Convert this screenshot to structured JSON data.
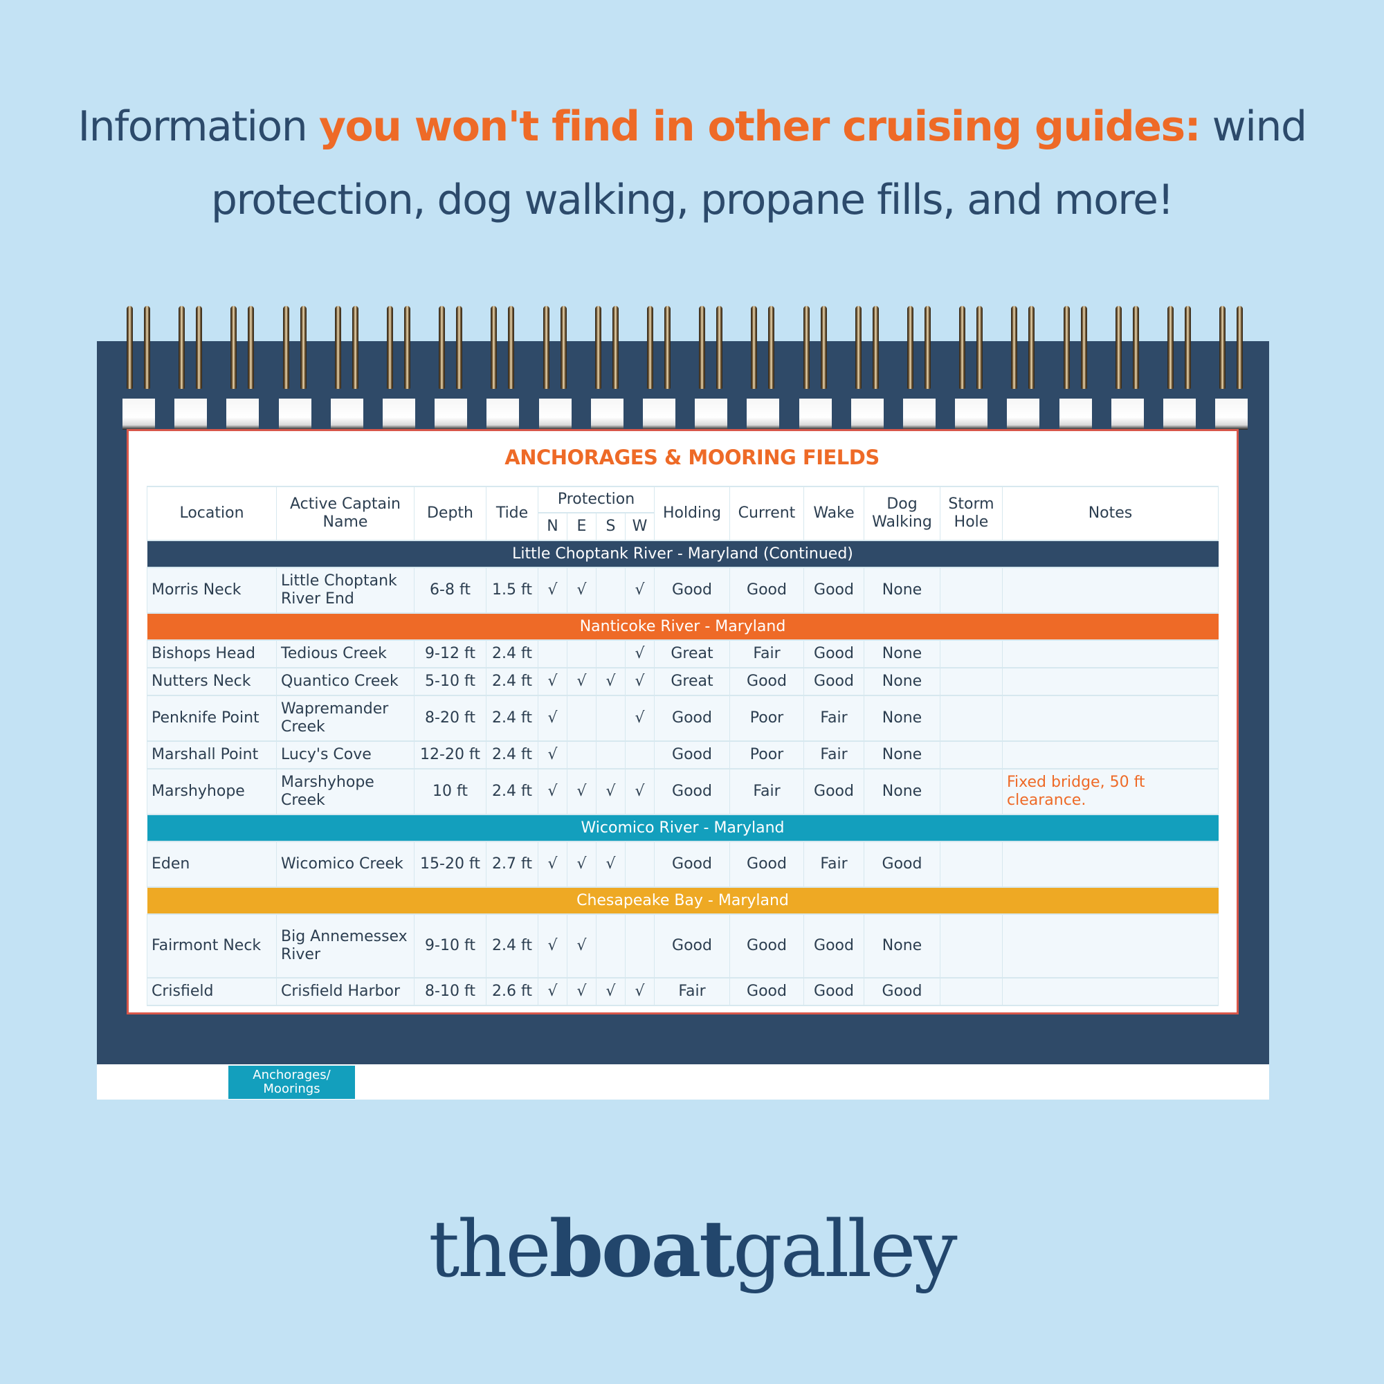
{
  "headline": {
    "part1": "Information ",
    "highlight": "you won't find in other cruising guides:",
    "part2": " wind protection, dog walking, propane fills, and more!"
  },
  "colors": {
    "background": "#c3e2f4",
    "navy": "#2f4a68",
    "orange": "#ee6a27",
    "teal": "#139fbd",
    "gold": "#eea924"
  },
  "page": {
    "title": "ANCHORAGES & MOORING FIELDS"
  },
  "table": {
    "headers": {
      "location": "Location",
      "active_captain": "Active Captain Name",
      "depth": "Depth",
      "tide": "Tide",
      "protection": "Protection",
      "directions": [
        "N",
        "E",
        "S",
        "W"
      ],
      "holding": "Holding",
      "current": "Current",
      "wake": "Wake",
      "dog_walking": "Dog Walking",
      "storm_hole": "Storm Hole",
      "notes": "Notes"
    },
    "check_glyph": "√",
    "sections": [
      {
        "title": "Little Choptank River - Maryland (Continued)",
        "color": "#2f4a68",
        "rows": [
          {
            "location": "Morris Neck",
            "active_captain": "Little Choptank River End",
            "depth": "6-8 ft",
            "tide": "1.5 ft",
            "N": true,
            "E": true,
            "S": false,
            "W": true,
            "holding": "Good",
            "current": "Good",
            "wake": "Good",
            "dog_walking": "None",
            "storm_hole": "",
            "notes": ""
          }
        ]
      },
      {
        "title": "Nanticoke River - Maryland",
        "color": "#ee6a27",
        "rows": [
          {
            "location": "Bishops Head",
            "active_captain": "Tedious Creek",
            "depth": "9-12 ft",
            "tide": "2.4 ft",
            "N": false,
            "E": false,
            "S": false,
            "W": true,
            "holding": "Great",
            "current": "Fair",
            "wake": "Good",
            "dog_walking": "None",
            "storm_hole": "",
            "notes": ""
          },
          {
            "location": "Nutters Neck",
            "active_captain": "Quantico Creek",
            "depth": "5-10 ft",
            "tide": "2.4 ft",
            "N": true,
            "E": true,
            "S": true,
            "W": true,
            "holding": "Great",
            "current": "Good",
            "wake": "Good",
            "dog_walking": "None",
            "storm_hole": "",
            "notes": ""
          },
          {
            "location": "Penknife Point",
            "active_captain": "Wapremander Creek",
            "depth": "8-20 ft",
            "tide": "2.4 ft",
            "N": true,
            "E": false,
            "S": false,
            "W": true,
            "holding": "Good",
            "current": "Poor",
            "wake": "Fair",
            "dog_walking": "None",
            "storm_hole": "",
            "notes": ""
          },
          {
            "location": "Marshall Point",
            "active_captain": "Lucy's Cove",
            "depth": "12-20 ft",
            "tide": "2.4 ft",
            "N": true,
            "E": false,
            "S": false,
            "W": false,
            "holding": "Good",
            "current": "Poor",
            "wake": "Fair",
            "dog_walking": "None",
            "storm_hole": "",
            "notes": ""
          },
          {
            "location": "Marshyhope",
            "active_captain": "Marshyhope Creek",
            "depth": "10 ft",
            "tide": "2.4 ft",
            "N": true,
            "E": true,
            "S": true,
            "W": true,
            "holding": "Good",
            "current": "Fair",
            "wake": "Good",
            "dog_walking": "None",
            "storm_hole": "",
            "notes": "Fixed bridge, 50 ft clearance."
          }
        ]
      },
      {
        "title": "Wicomico River - Maryland",
        "color": "#139fbd",
        "rows": [
          {
            "location": "Eden",
            "active_captain": "Wicomico Creek",
            "depth": "15-20 ft",
            "tide": "2.7 ft",
            "N": true,
            "E": true,
            "S": true,
            "W": false,
            "holding": "Good",
            "current": "Good",
            "wake": "Fair",
            "dog_walking": "Good",
            "storm_hole": "",
            "notes": ""
          }
        ]
      },
      {
        "title": "Chesapeake Bay - Maryland",
        "color": "#eea924",
        "rows": [
          {
            "location": "Fairmont Neck",
            "active_captain": "Big Annemessex River",
            "depth": "9-10 ft",
            "tide": "2.4 ft",
            "N": true,
            "E": true,
            "S": false,
            "W": false,
            "holding": "Good",
            "current": "Good",
            "wake": "Good",
            "dog_walking": "None",
            "storm_hole": "",
            "notes": ""
          },
          {
            "location": "Crisfield",
            "active_captain": "Crisfield Harbor",
            "depth": "8-10 ft",
            "tide": "2.6 ft",
            "N": true,
            "E": true,
            "S": true,
            "W": true,
            "holding": "Fair",
            "current": "Good",
            "wake": "Good",
            "dog_walking": "Good",
            "storm_hole": "",
            "notes": ""
          }
        ]
      }
    ]
  },
  "tab": {
    "label": "Anchorages/\nMoorings"
  },
  "brand": {
    "part1": "the",
    "bold": "boat",
    "part2": "galley"
  }
}
